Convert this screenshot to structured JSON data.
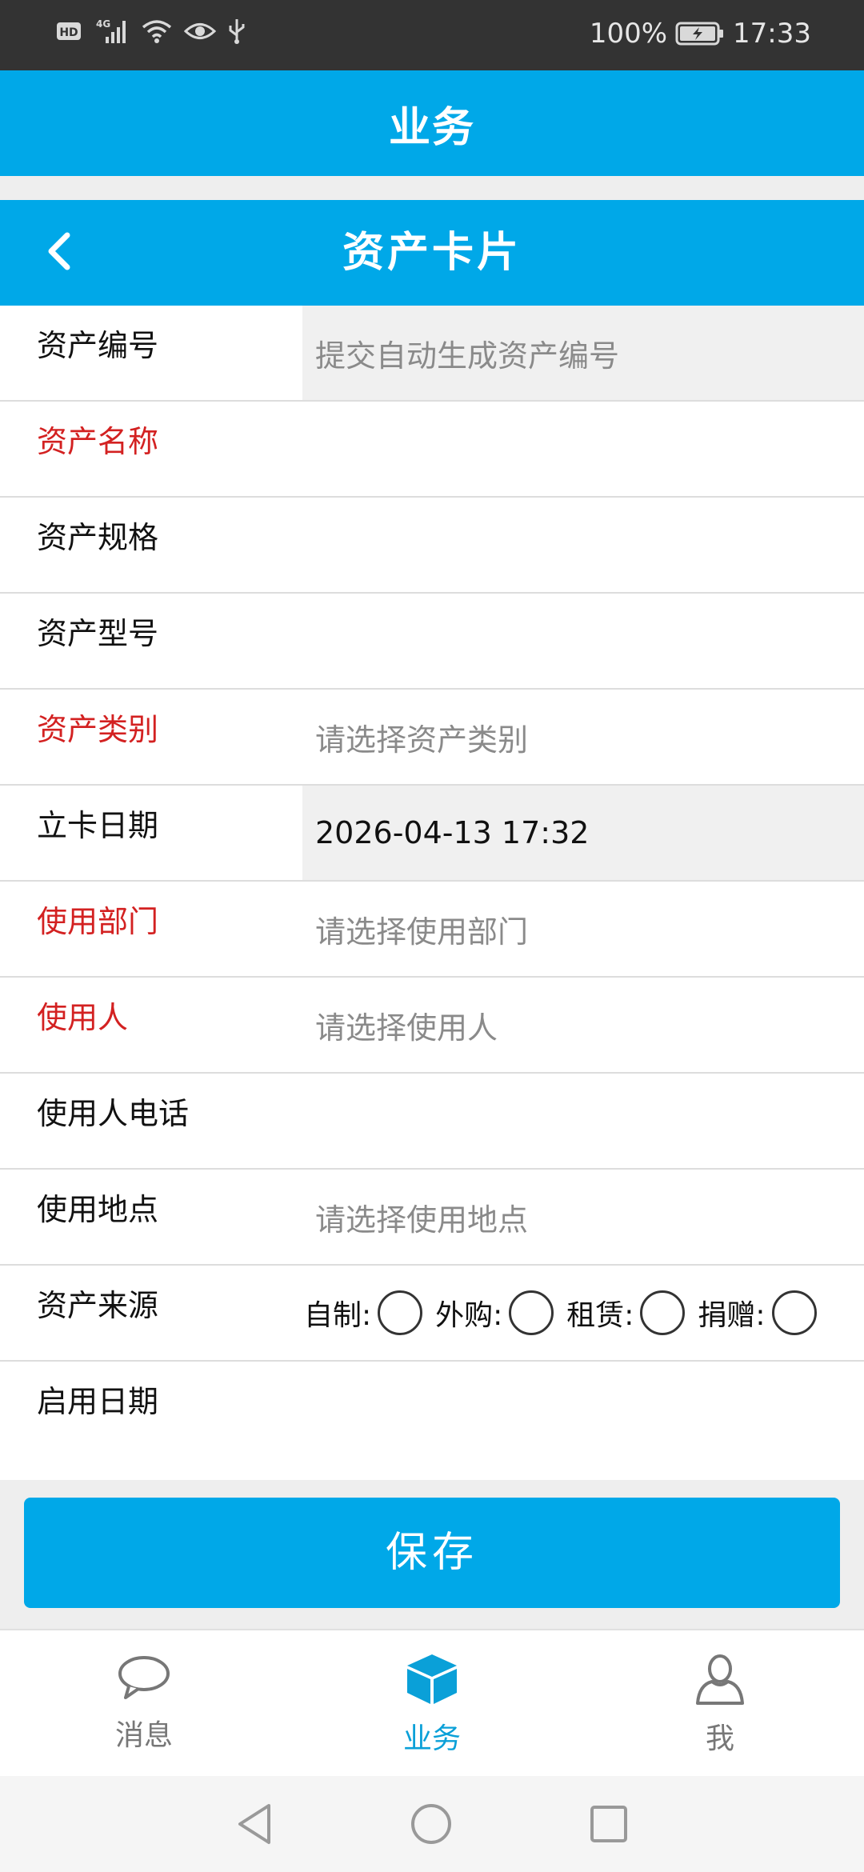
{
  "status_bar": {
    "left_icons": [
      "hd-icon",
      "4g-signal-icon",
      "wifi-icon",
      "eye-icon",
      "usb-icon"
    ],
    "battery": "100%",
    "time": "17:33"
  },
  "app_bar": {
    "title": "业务"
  },
  "sub_header": {
    "title": "资产卡片",
    "back_icon": "chevron-left-icon"
  },
  "form": {
    "asset_no": {
      "label": "资产编号",
      "placeholder": "提交自动生成资产编号"
    },
    "asset_name": {
      "label": "资产名称"
    },
    "asset_spec": {
      "label": "资产规格"
    },
    "asset_model": {
      "label": "资产型号"
    },
    "asset_category": {
      "label": "资产类别",
      "placeholder": "请选择资产类别"
    },
    "card_date": {
      "label": "立卡日期",
      "value": "2026-04-13 17:32"
    },
    "department": {
      "label": "使用部门",
      "placeholder": "请选择使用部门"
    },
    "user": {
      "label": "使用人",
      "placeholder": "请选择使用人"
    },
    "user_phone": {
      "label": "使用人电话"
    },
    "location": {
      "label": "使用地点",
      "placeholder": "请选择使用地点"
    },
    "source": {
      "label": "资产来源",
      "options": [
        "自制:",
        "外购:",
        "租赁:",
        "捐赠:"
      ]
    },
    "start_date": {
      "label": "启用日期"
    }
  },
  "save_button": {
    "label": "保存"
  },
  "tab_bar": {
    "tabs": [
      {
        "label": "消息",
        "icon": "chat-bubble-icon"
      },
      {
        "label": "业务",
        "icon": "cube-icon"
      },
      {
        "label": "我",
        "icon": "person-icon"
      }
    ],
    "active_index": 1
  },
  "colors": {
    "primary": "#00a8e8",
    "required": "#d32121",
    "placeholder": "#8a8a8a"
  }
}
